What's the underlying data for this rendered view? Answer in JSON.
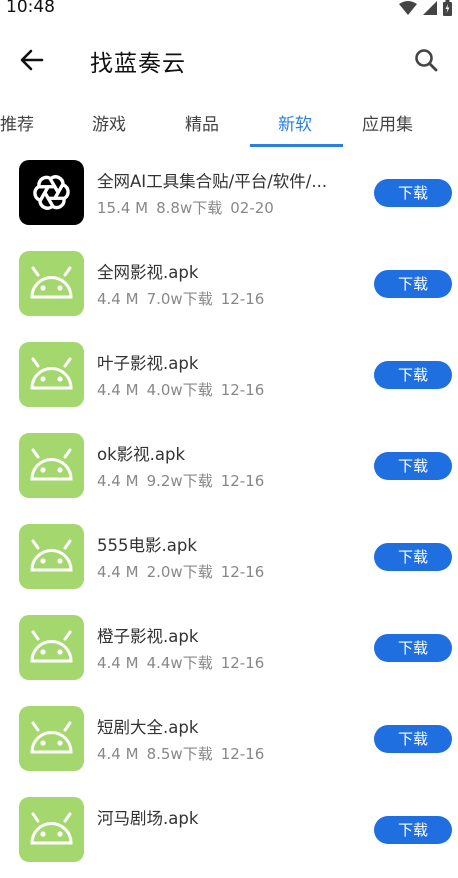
{
  "status_bar": {
    "time": "10:48"
  },
  "header": {
    "title": "找蓝奏云"
  },
  "tabs": [
    {
      "label": "推荐"
    },
    {
      "label": "游戏"
    },
    {
      "label": "精品"
    },
    {
      "label": "新软"
    },
    {
      "label": "应用集"
    }
  ],
  "active_tab": "新软",
  "download_label": "下载",
  "apps": [
    {
      "name": "全网AI工具集合贴/平台/软件/...",
      "size": "15.4 M",
      "downloads": "8.8w下载",
      "date": "02-20",
      "icon": "openai-icon"
    },
    {
      "name": "全网影视.apk",
      "size": "4.4 M",
      "downloads": "7.0w下载",
      "date": "12-16",
      "icon": "android-icon"
    },
    {
      "name": "叶子影视.apk",
      "size": "4.4 M",
      "downloads": "4.0w下载",
      "date": "12-16",
      "icon": "android-icon"
    },
    {
      "name": "ok影视.apk",
      "size": "4.4 M",
      "downloads": "9.2w下载",
      "date": "12-16",
      "icon": "android-icon"
    },
    {
      "name": "555电影.apk",
      "size": "4.4 M",
      "downloads": "2.0w下载",
      "date": "12-16",
      "icon": "android-icon"
    },
    {
      "name": "橙子影视.apk",
      "size": "4.4 M",
      "downloads": "4.4w下载",
      "date": "12-16",
      "icon": "android-icon"
    },
    {
      "name": "短剧大全.apk",
      "size": "4.4 M",
      "downloads": "8.5w下载",
      "date": "12-16",
      "icon": "android-icon"
    },
    {
      "name": "河马剧场.apk",
      "size": "",
      "downloads": "",
      "date": "",
      "icon": "android-icon"
    }
  ],
  "colors": {
    "accent": "#2a7fe0",
    "button": "#1f6fe0",
    "android_green": "#a4d86e"
  }
}
